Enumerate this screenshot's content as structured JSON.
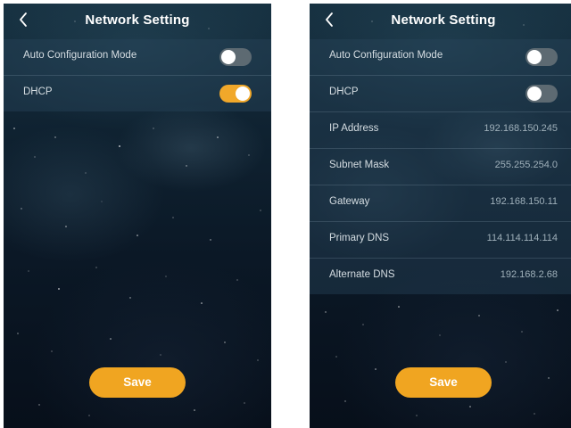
{
  "colors": {
    "accent": "#f0a521",
    "toggle_off": "#5d6a72",
    "text_primary": "#ffffff",
    "text_label": "#d5dde2",
    "text_value": "#9fb0ba"
  },
  "screens": [
    {
      "title": "Network Setting",
      "back_icon": "chevron-left-icon",
      "rows": [
        {
          "label": "Auto Configuration Mode",
          "toggle": "off"
        },
        {
          "label": "DHCP",
          "toggle": "on"
        }
      ],
      "save_label": "Save"
    },
    {
      "title": "Network Setting",
      "back_icon": "chevron-left-icon",
      "rows": [
        {
          "label": "Auto Configuration Mode",
          "toggle": "off"
        },
        {
          "label": "DHCP",
          "toggle": "off"
        },
        {
          "label": "IP Address",
          "value": "192.168.150.245"
        },
        {
          "label": "Subnet Mask",
          "value": "255.255.254.0"
        },
        {
          "label": "Gateway",
          "value": "192.168.150.11"
        },
        {
          "label": "Primary DNS",
          "value": "114.114.114.114"
        },
        {
          "label": "Alternate DNS",
          "value": "192.168.2.68"
        }
      ],
      "save_label": "Save"
    }
  ]
}
